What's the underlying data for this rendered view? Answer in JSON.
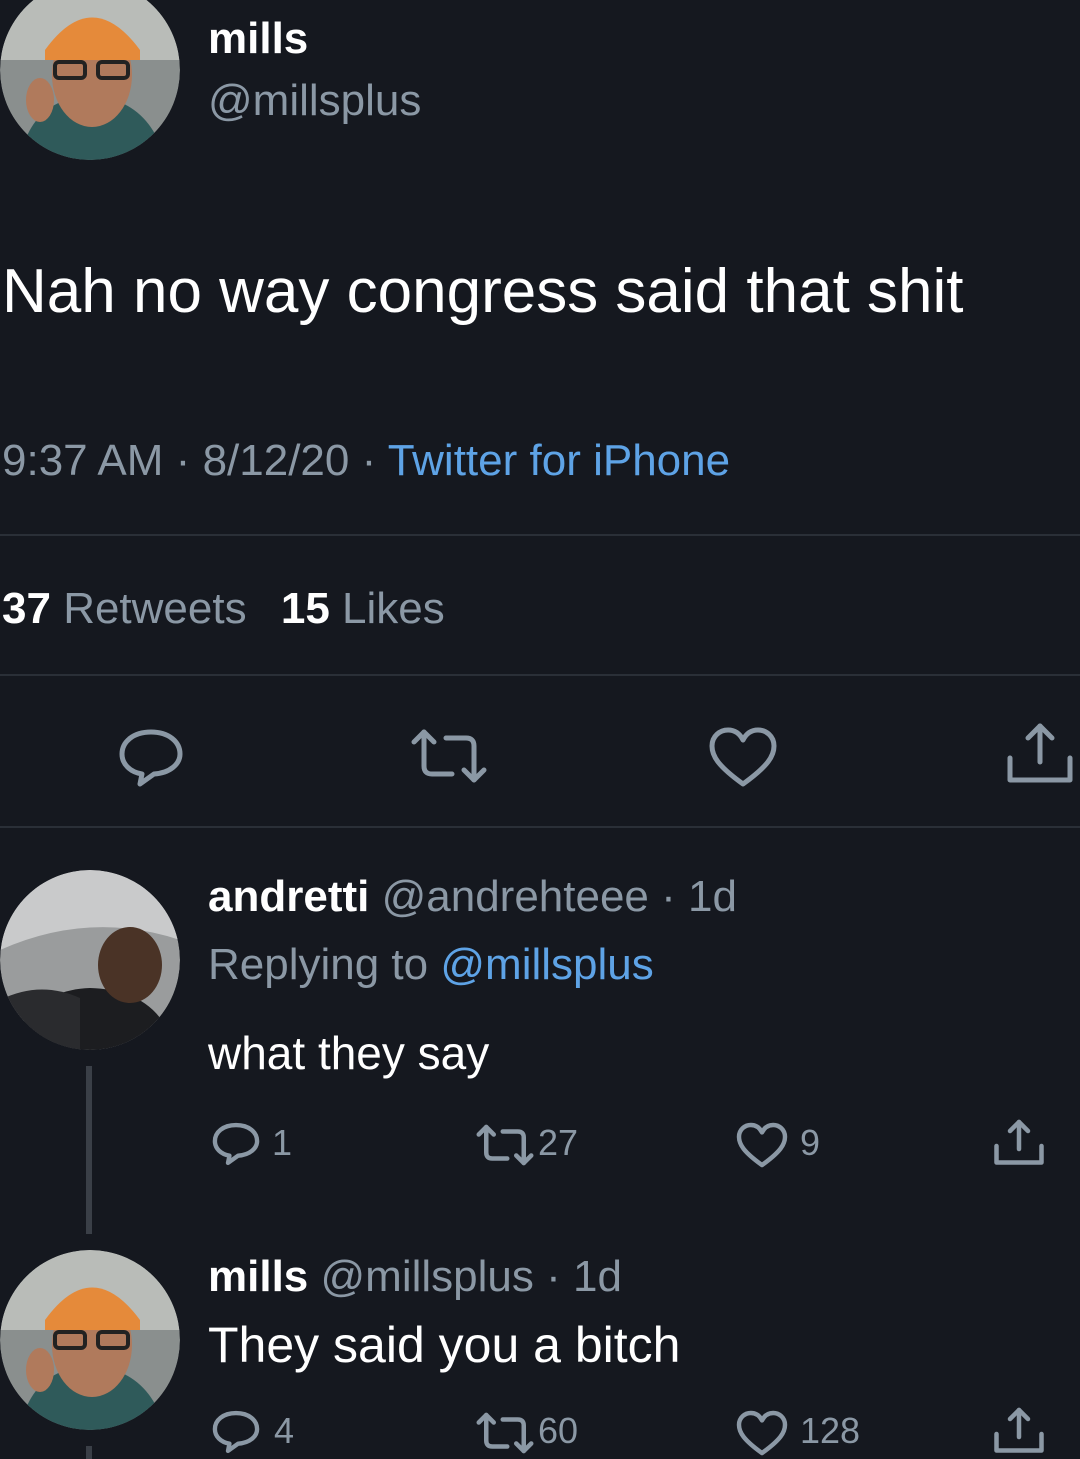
{
  "main_tweet": {
    "display_name": "mills",
    "handle": "@millsplus",
    "text": "Nah no way congress said that shit",
    "time": "9:37 AM",
    "date": "8/12/20",
    "source": "Twitter for iPhone",
    "sep": "·",
    "retweets_count": "37",
    "retweets_label": "Retweets",
    "likes_count": "15",
    "likes_label": "Likes"
  },
  "reply1": {
    "display_name": "andretti",
    "handle": "@andrehteee",
    "age": "· 1d",
    "replying_prefix": "Replying to",
    "replying_to": "@millsplus",
    "text": "what they say",
    "replies": "1",
    "retweets": "27",
    "likes": "9"
  },
  "reply2": {
    "display_name": "mills",
    "handle": "@millsplus",
    "age": "· 1d",
    "text": "They said you a bitch",
    "replies": "4",
    "retweets": "60",
    "likes": "128"
  },
  "colors": {
    "background": "#15181f",
    "accent": "#5ea3e6",
    "muted": "#8b98a5"
  }
}
